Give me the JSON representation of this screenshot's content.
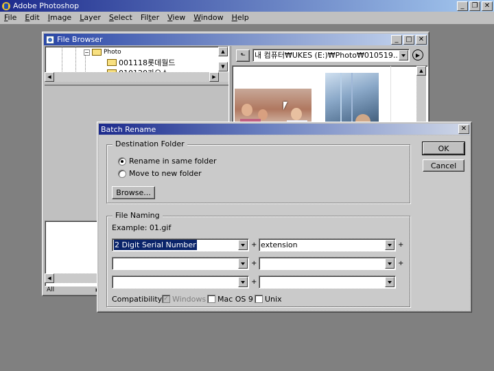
{
  "app": {
    "title": "Adobe Photoshop",
    "menu": [
      "File",
      "Edit",
      "Image",
      "Layer",
      "Select",
      "Filter",
      "View",
      "Window",
      "Help"
    ],
    "menu_accel": [
      "F",
      "E",
      "I",
      "L",
      "S",
      "t",
      "V",
      "W",
      "H"
    ]
  },
  "file_browser": {
    "title": "File Browser",
    "tree": {
      "root": "Photo",
      "items": [
        "001118롯데월드",
        "010120카오스"
      ]
    },
    "location_path": "내 컴퓨터₩UKES (E:)₩Photo₩010519...",
    "status_all": "All"
  },
  "dialog": {
    "title": "Batch Rename",
    "destination": {
      "group_label": "Destination Folder",
      "option_same": "Rename in same folder",
      "option_new": "Move to new folder",
      "selected": "same",
      "browse_label": "Browse..."
    },
    "naming": {
      "group_label": "File Naming",
      "example": "Example: 01.gif",
      "fields": [
        [
          "2 Digit Serial Number",
          "extension"
        ],
        [
          "",
          ""
        ],
        [
          "",
          ""
        ]
      ],
      "plus": "+"
    },
    "compatibility": {
      "label": "Compatibility:",
      "windows": "Windows",
      "macos": "Mac OS 9",
      "unix": "Unix",
      "windows_checked": true,
      "windows_disabled": true
    },
    "ok_label": "OK",
    "cancel_label": "Cancel"
  },
  "colors": {
    "title_active_start": "#1c2a8c",
    "title_active_end": "#a6caf0",
    "selection": "#0a246a"
  }
}
